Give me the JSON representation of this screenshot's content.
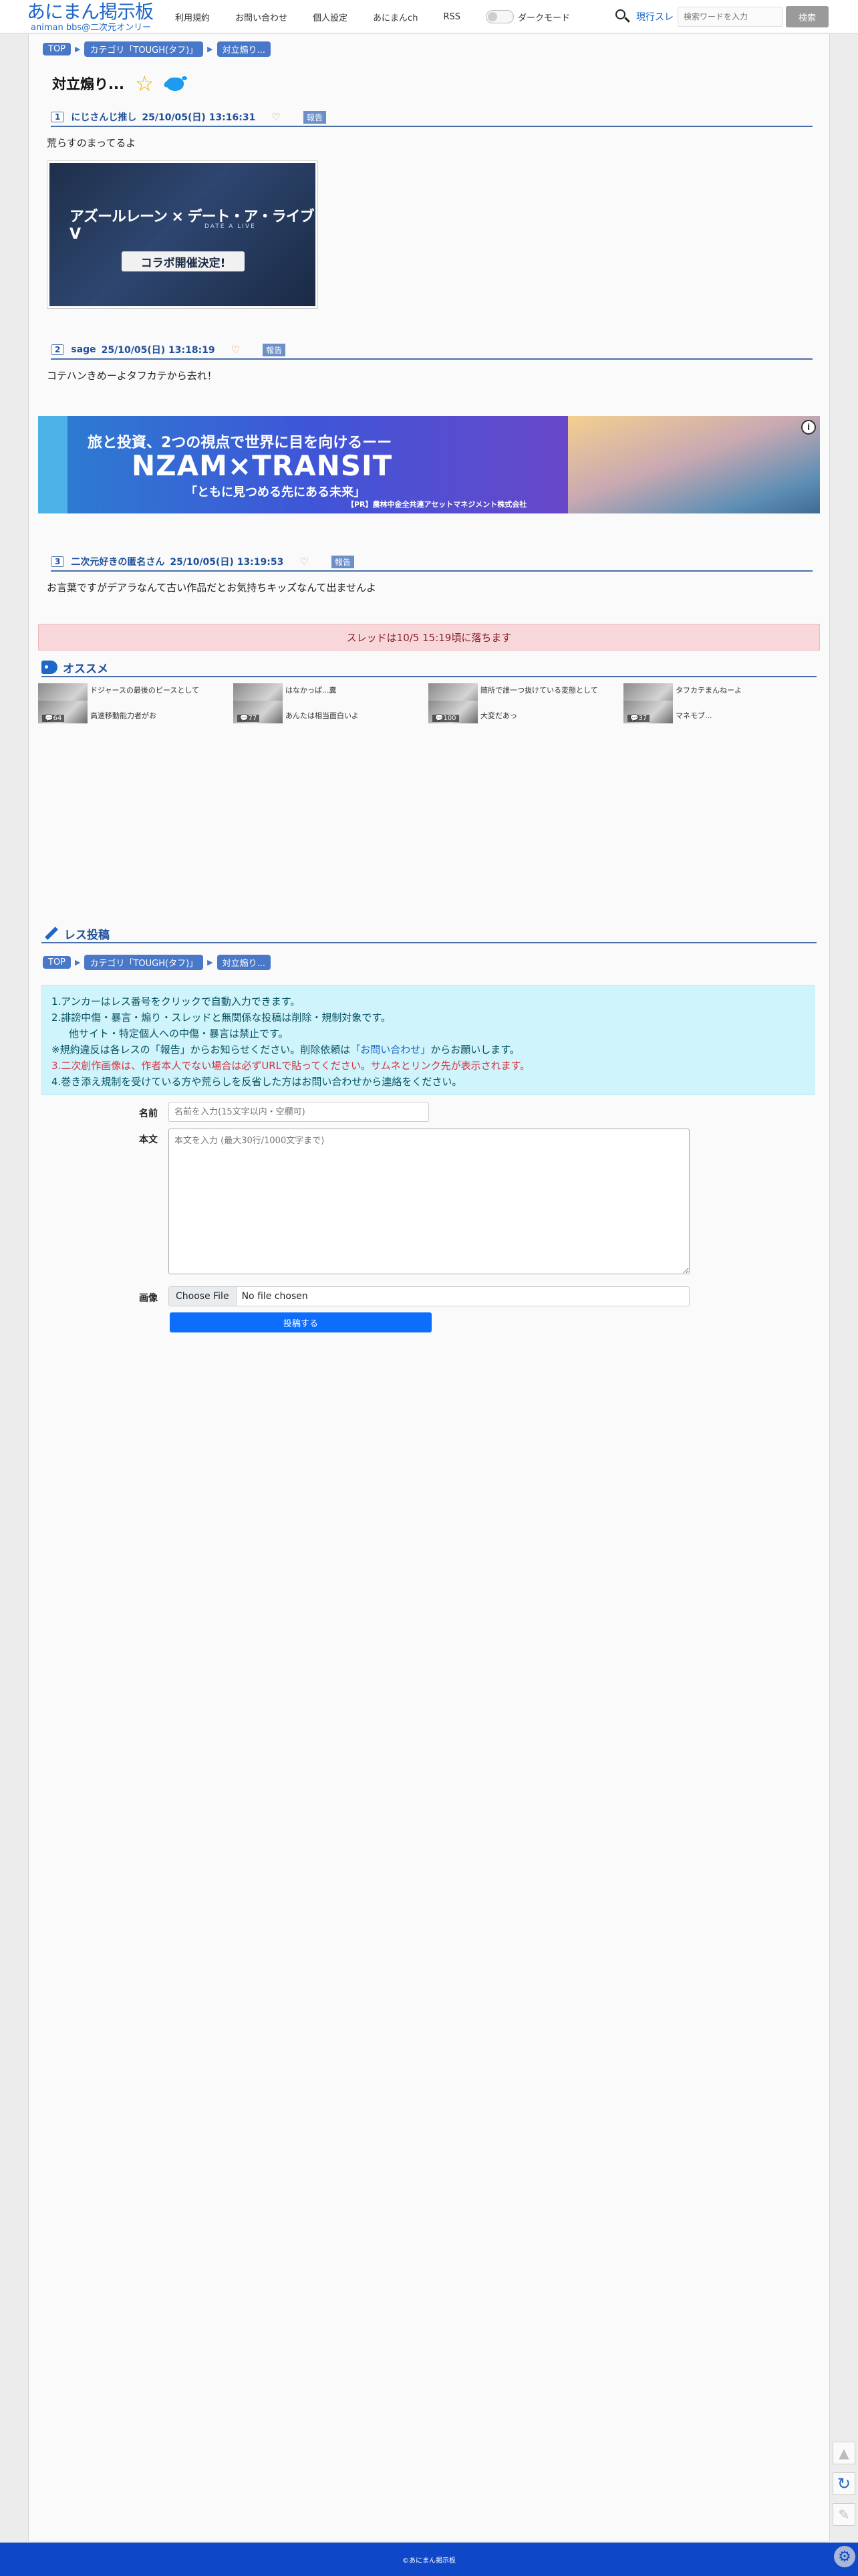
{
  "header": {
    "logo_main": "あにまん掲示板",
    "logo_sub": "animan bbs@二次元オンリー",
    "nav": [
      "利用規約",
      "お問い合わせ",
      "個人設定",
      "あにまんch",
      "RSS"
    ],
    "dark_mode_label": "ダークモード",
    "hot_threads": "現行スレ",
    "search_placeholder": "検索ワードを入力",
    "search_button": "検索"
  },
  "breadcrumb": [
    "TOP",
    "カテゴリ「TOUGH(タフ)」",
    "対立煽り..."
  ],
  "thread_title": "対立煽り...",
  "posts": [
    {
      "no": "1",
      "name": "にじさんじ推し",
      "date": "25/10/05(日) 13:16:31",
      "report": "報告",
      "body": "荒らすのまってるよ"
    },
    {
      "no": "2",
      "name": "sage",
      "date": "25/10/05(日) 13:18:19",
      "report": "報告",
      "body": "コテハンきめーよタフカテから去れ！"
    },
    {
      "no": "3",
      "name": "二次元好きの匿名さん",
      "date": "25/10/05(日) 13:19:53",
      "report": "報告",
      "body": "お言葉ですがデアラなんて古い作品だとお気持ちキッズなんて出ませんよ"
    }
  ],
  "attachment": {
    "line1": "アズールレーン × デート・ア・ライブV",
    "line2": "DATE A LIVE",
    "pill": "コラボ開催決定!"
  },
  "ad": {
    "line1": "旅と投資、2つの視点で世界に目を向けるーー",
    "line2": "NZAM×TRANSIT",
    "line3": "「ともに見つめる先にある未来」",
    "pr": "【PR】農林中金全共連アセットマネジメント株式会社"
  },
  "notice": "スレッドは10/5 15:19頃に落ちます",
  "recommend": {
    "heading": "オススメ",
    "items": [
      {
        "title": "ドジャースの最後のピースとして",
        "count": "61"
      },
      {
        "title": "はなかっぱ...糞",
        "count": "47"
      },
      {
        "title": "随所で誰一つ抜けている変態として",
        "count": "40"
      },
      {
        "title": "タフカテまんねーよ",
        "count": "30"
      },
      {
        "title": "高速移動能力者がお",
        "count": "64"
      },
      {
        "title": "あんたは相当面白いよ",
        "count": "77"
      },
      {
        "title": "大変だあっ",
        "count": "100"
      },
      {
        "title": "マネモブ...",
        "count": "37"
      }
    ]
  },
  "form": {
    "heading": "レス投稿",
    "rules": [
      "1.アンカーはレス番号をクリックで自動入力できます。",
      "2.誹謗中傷・暴言・煽り・スレッドと無関係な投稿は削除・規制対象です。",
      "他サイト・特定個人への中傷・暴言は禁止です。",
      "※規約違反は各レスの「報告」からお知らせください。削除依頼は",
      "「お問い合わせ」",
      "からお願いします。",
      "3.二次創作画像は、作者本人でない場合は必ずURLで貼ってください。サムネとリンク先が表示されます。",
      "4.巻き添え規制を受けている方や荒らしを反省した方はお問い合わせから連絡をください。"
    ],
    "name_label": "名前",
    "name_placeholder": "名前を入力(15文字以内・空欄可)",
    "body_label": "本文",
    "body_placeholder": "本文を入力 (最大30行/1000文字まで)",
    "image_label": "画像",
    "choose_file": "Choose File",
    "no_file": "No file chosen",
    "submit": "投稿する"
  },
  "footer": "©あにまん掲示板"
}
